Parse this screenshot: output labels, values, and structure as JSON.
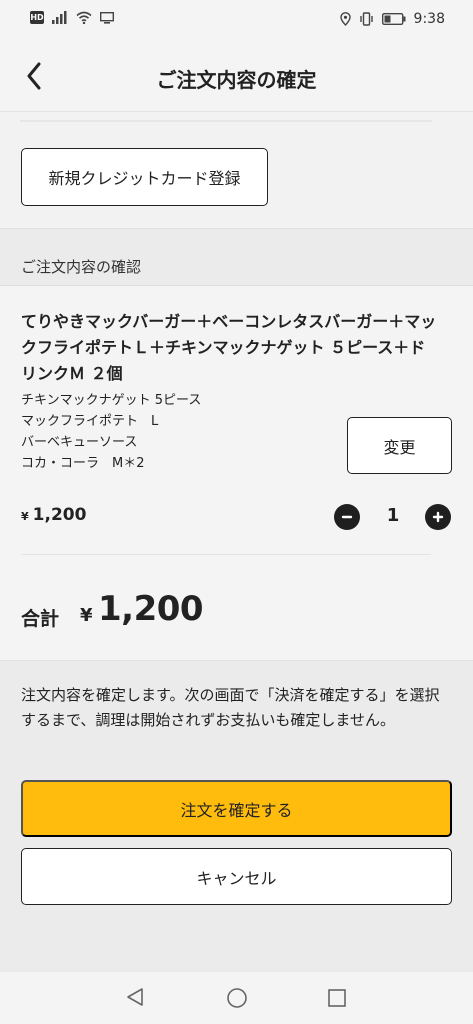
{
  "status_bar": {
    "hd_label": "HD",
    "time": "9:38"
  },
  "header": {
    "title": "ご注文内容の確定"
  },
  "payment": {
    "new_card_button": "新規クレジットカード登録"
  },
  "section": {
    "title": "ご注文内容の確認"
  },
  "order": {
    "item_title": "てりやきマックバーガー＋ベーコンレタスバーガー＋マックフライポテトＬ＋チキンマックナゲット ５ピース＋ドリンクＭ ２個",
    "options": [
      "チキンマックナゲット 5ピース",
      "マックフライポテト　L",
      "バーベキューソース",
      "コカ・コーラ　M＊2"
    ],
    "change_button": "変更",
    "price_symbol": "¥",
    "price": "1,200",
    "quantity": "1"
  },
  "total": {
    "label": "合計",
    "symbol": "¥",
    "value": "1,200"
  },
  "footer": {
    "notice": "注文内容を確定します。次の画面で「決済を確定する」を選択するまで、調理は開始されずお支払いも確定しません。",
    "confirm_button": "注文を確定する",
    "cancel_button": "キャンセル"
  },
  "colors": {
    "accent": "#ffbc0d",
    "dark": "#1f1f1f"
  }
}
